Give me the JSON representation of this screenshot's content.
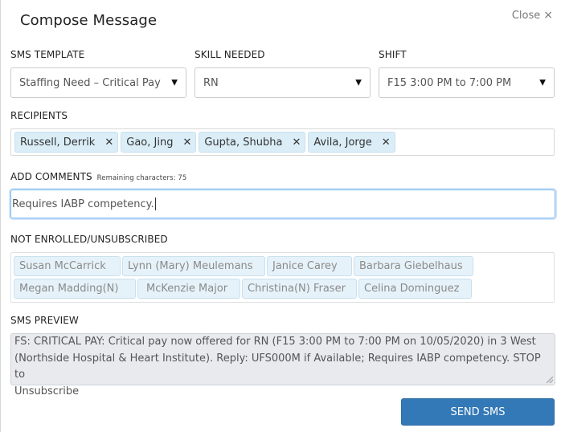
{
  "dialog": {
    "title": "Compose Message",
    "close_label": "Close",
    "close_icon": "×"
  },
  "fields": {
    "sms_template": {
      "label": "SMS TEMPLATE",
      "value": "Staffing Need – Critical Pay"
    },
    "skill_needed": {
      "label": "SKILL NEEDED",
      "value": "RN"
    },
    "shift": {
      "label": "SHIFT",
      "value": "F15 3:00 PM to 7:00 PM"
    },
    "dropdown_icon": "▼"
  },
  "recipients": {
    "label": "RECIPIENTS",
    "remove_icon": "✕",
    "items": [
      "Russell, Derrik",
      "Gao, Jing",
      "Gupta, Shubha",
      "Avila, Jorge"
    ]
  },
  "comments": {
    "label": "ADD COMMENTS",
    "remaining_label": "Remaining characters: 75",
    "value": "Requires IABP competency."
  },
  "not_enrolled": {
    "label": "NOT ENROLLED/UNSUBSCRIBED",
    "rows": [
      [
        "Susan McCarrick",
        "Lynn (Mary) Meulemans",
        "Janice Carey",
        "Barbara Giebelhaus"
      ],
      [
        "Megan Madding(N)",
        "McKenzie Major",
        "Christina(N) Fraser",
        "Celina Dominguez"
      ]
    ]
  },
  "preview": {
    "label": "SMS PREVIEW",
    "lines": [
      "FS: CRITICAL PAY: Critical pay now offered for RN (F15 3:00 PM to 7:00 PM on 10/05/2020) in 3 West",
      "(Northside Hospital & Heart Institute). Reply: UFS000M if Available; Requires IABP competency. STOP to",
      "Unsubscribe"
    ]
  },
  "actions": {
    "send_label": "SEND SMS"
  }
}
